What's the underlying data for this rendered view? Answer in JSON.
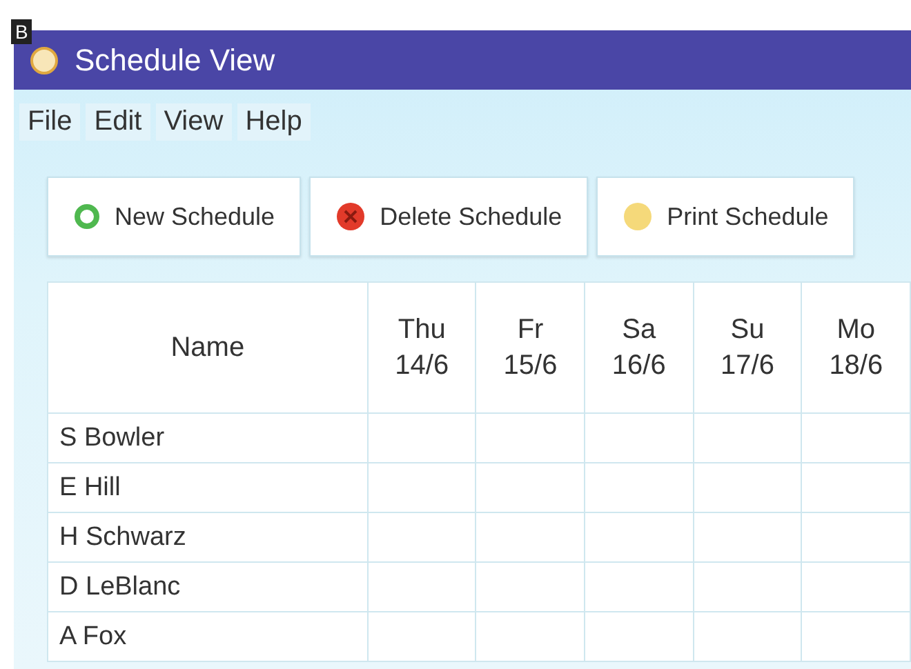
{
  "figure_label": "B",
  "window": {
    "title": "Schedule View"
  },
  "menu": [
    "File",
    "Edit",
    "View",
    "Help"
  ],
  "toolbar": [
    {
      "label": "New Schedule",
      "kind": "new"
    },
    {
      "label": "Delete Schedule",
      "kind": "delete"
    },
    {
      "label": "Print Schedule",
      "kind": "print"
    }
  ],
  "table": {
    "name_header": "Name",
    "days": [
      {
        "day": "Thu",
        "date": "14/6"
      },
      {
        "day": "Fr",
        "date": "15/6"
      },
      {
        "day": "Sa",
        "date": "16/6"
      },
      {
        "day": "Su",
        "date": "17/6"
      },
      {
        "day": "Mo",
        "date": "18/6"
      }
    ],
    "rows": [
      "S Bowler",
      "E Hill",
      "H Schwarz",
      "D LeBlanc",
      "A Fox"
    ]
  }
}
